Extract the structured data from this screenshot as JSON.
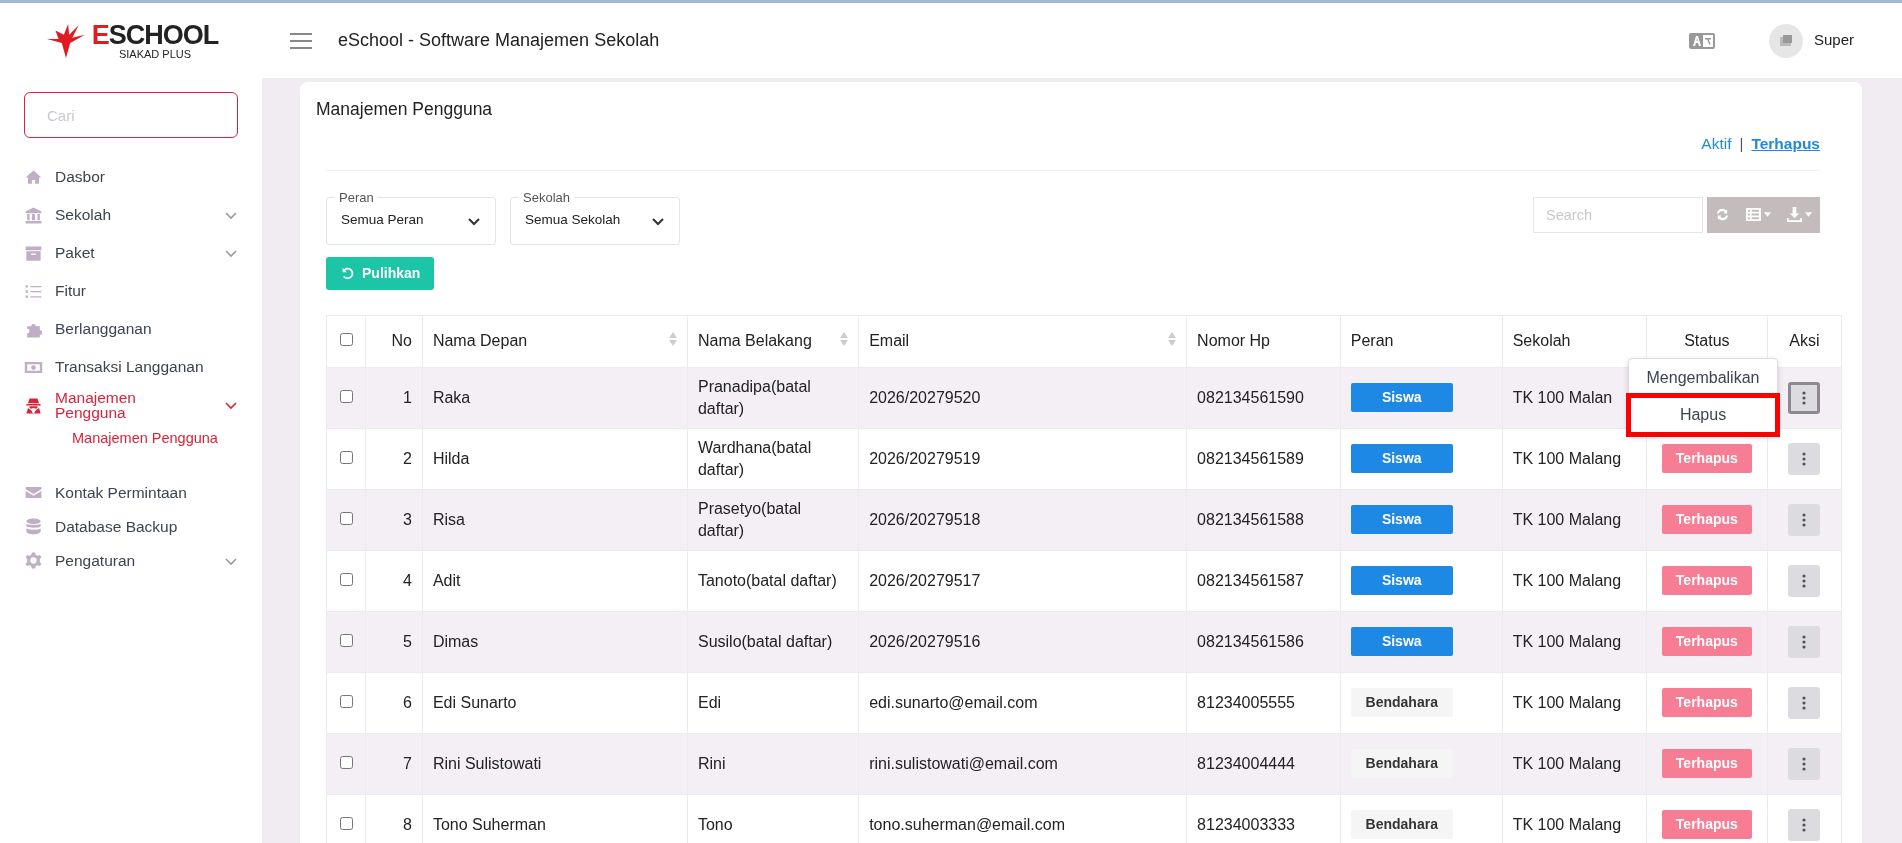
{
  "brand": {
    "name": "ESCHOOL",
    "tagline": "SIAKAD PLUS"
  },
  "header": {
    "title": "eSchool - Software Manajemen Sekolah",
    "user": "Super"
  },
  "sidebar": {
    "search_placeholder": "Cari",
    "items": [
      {
        "label": "Dasbor",
        "expandable": false,
        "selected": false
      },
      {
        "label": "Sekolah",
        "expandable": true,
        "expanded": false,
        "selected": false
      },
      {
        "label": "Paket",
        "expandable": true,
        "expanded": false,
        "selected": false
      },
      {
        "label": "Fitur",
        "expandable": false,
        "selected": false
      },
      {
        "label": "Berlangganan",
        "expandable": false,
        "selected": false
      },
      {
        "label": "Transaksi Langganan",
        "expandable": false,
        "selected": false
      },
      {
        "label": "Manajemen Pengguna",
        "expandable": true,
        "expanded": true,
        "selected": true,
        "children": [
          {
            "label": "Manajemen Pengguna",
            "selected": true
          }
        ]
      },
      {
        "label": "Kontak Permintaan",
        "expandable": false,
        "selected": false
      },
      {
        "label": "Database Backup",
        "expandable": false,
        "selected": false
      },
      {
        "label": "Pengaturan",
        "expandable": true,
        "expanded": false,
        "selected": false
      }
    ]
  },
  "page": {
    "title": "Manajemen Pengguna",
    "views": [
      {
        "label": "Aktif",
        "selected": false
      },
      {
        "label": "Terhapus",
        "selected": true
      }
    ],
    "views_separator": "|",
    "filters": [
      {
        "label": "Peran",
        "value": "Semua Peran"
      },
      {
        "label": "Sekolah",
        "value": "Semua Sekolah"
      }
    ],
    "restore_button": "Pulihkan",
    "search_placeholder": "Search",
    "table": {
      "columns": [
        {
          "label": "No",
          "sortable": false
        },
        {
          "label": "Nama Depan",
          "sortable": true
        },
        {
          "label": "Nama Belakang",
          "sortable": true
        },
        {
          "label": "Email",
          "sortable": true
        },
        {
          "label": "Nomor Hp",
          "sortable": false
        },
        {
          "label": "Peran",
          "sortable": false
        },
        {
          "label": "Sekolah",
          "sortable": false
        },
        {
          "label": "Status",
          "sortable": false
        },
        {
          "label": "Aksi",
          "sortable": false
        }
      ],
      "select_all_checked": false,
      "rows": [
        {
          "checked": false,
          "no": "1",
          "first_name": "Raka",
          "last_name": "Pranadipa(batal daftar)",
          "email": "2026/20279520",
          "phone": "082134561590",
          "role": {
            "label": "Siswa",
            "kind": "primary"
          },
          "school": "TK 100 Malan",
          "menu_open": true
        },
        {
          "checked": false,
          "no": "2",
          "first_name": "Hilda",
          "last_name": "Wardhana(batal daftar)",
          "email": "2026/20279519",
          "phone": "082134561589",
          "role": {
            "label": "Siswa",
            "kind": "primary"
          },
          "school": "TK 100 Malang",
          "status": "Terhapus",
          "menu_open": false
        },
        {
          "checked": false,
          "no": "3",
          "first_name": "Risa",
          "last_name": "Prasetyo(batal daftar)",
          "email": "2026/20279518",
          "phone": "082134561588",
          "role": {
            "label": "Siswa",
            "kind": "primary"
          },
          "school": "TK 100 Malang",
          "status": "Terhapus",
          "menu_open": false
        },
        {
          "checked": false,
          "no": "4",
          "first_name": "Adit",
          "last_name": "Tanoto(batal daftar)",
          "email": "2026/20279517",
          "phone": "082134561587",
          "role": {
            "label": "Siswa",
            "kind": "primary"
          },
          "school": "TK 100 Malang",
          "status": "Terhapus",
          "menu_open": false
        },
        {
          "checked": false,
          "no": "5",
          "first_name": "Dimas",
          "last_name": "Susilo(batal daftar)",
          "email": "2026/20279516",
          "phone": "082134561586",
          "role": {
            "label": "Siswa",
            "kind": "primary"
          },
          "school": "TK 100 Malang",
          "status": "Terhapus",
          "menu_open": false
        },
        {
          "checked": false,
          "no": "6",
          "first_name": "Edi Sunarto",
          "last_name": "Edi",
          "email": "edi.sunarto@email.com",
          "phone": "81234005555",
          "role": {
            "label": "Bendahara",
            "kind": "light"
          },
          "school": "TK 100 Malang",
          "status": "Terhapus",
          "menu_open": false
        },
        {
          "checked": false,
          "no": "7",
          "first_name": "Rini Sulistowati",
          "last_name": "Rini",
          "email": "rini.sulistowati@email.com",
          "phone": "81234004444",
          "role": {
            "label": "Bendahara",
            "kind": "light"
          },
          "school": "TK 100 Malang",
          "status": "Terhapus",
          "menu_open": false
        },
        {
          "checked": false,
          "no": "8",
          "first_name": "Tono Suherman",
          "last_name": "Tono",
          "email": "tono.suherman@email.com",
          "phone": "81234003333",
          "role": {
            "label": "Bendahara",
            "kind": "light"
          },
          "school": "TK 100 Malang",
          "status": "Terhapus",
          "menu_open": false
        }
      ],
      "row_menu": {
        "items": [
          {
            "label": "Mengembalikan",
            "highlighted": false
          },
          {
            "label": "Hapus",
            "highlighted": true
          }
        ]
      }
    }
  }
}
